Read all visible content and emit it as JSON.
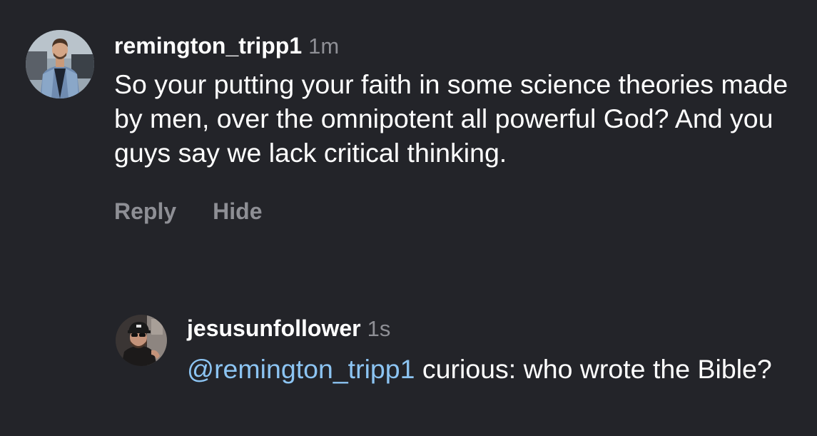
{
  "colors": {
    "background": "#232429",
    "text": "#ffffff",
    "muted": "#8e8f95",
    "mention": "#8cc4f2"
  },
  "comment": {
    "username": "remington_tripp1",
    "time": "1m",
    "text": "So your putting your faith in some science theories made by men, over the omnipotent all powerful God? And you guys say we lack critical thinking.",
    "avatar_icon": "user-avatar-photo",
    "actions": {
      "reply": "Reply",
      "hide": "Hide"
    }
  },
  "reply": {
    "username": "jesusunfollower",
    "time": "1s",
    "mention": "@remington_tripp1",
    "text": " curious: who wrote the Bible?",
    "avatar_icon": "user-avatar-photo"
  }
}
